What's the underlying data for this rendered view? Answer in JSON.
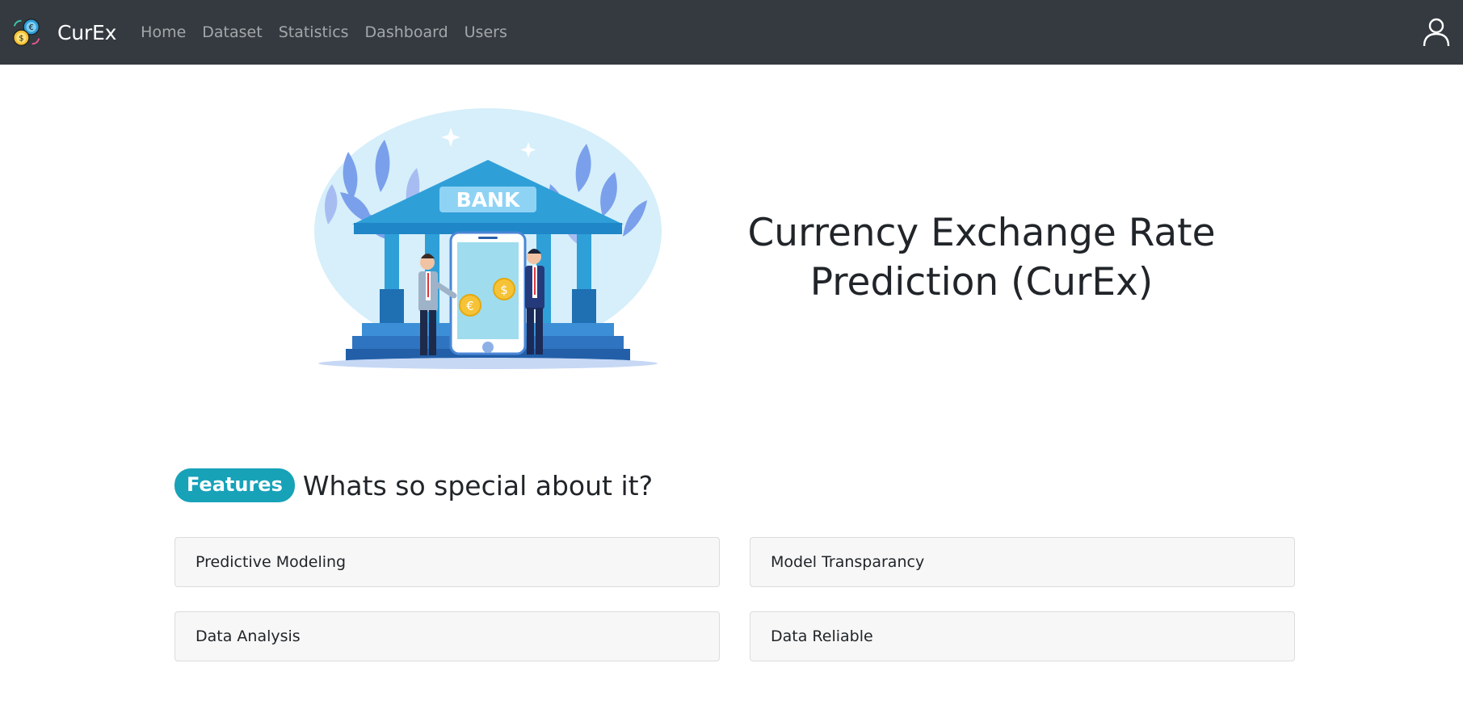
{
  "navbar": {
    "brand": "CurEx",
    "links": [
      "Home",
      "Dataset",
      "Statistics",
      "Dashboard",
      "Users"
    ],
    "user_icon": "user-icon",
    "background": "#343a40"
  },
  "hero": {
    "image_text": "BANK",
    "title_line1": "Currency Exchange Rate",
    "title_line2": "Prediction (CurEx)"
  },
  "features": {
    "badge": "Features",
    "heading": "Whats so special about it?",
    "badge_color": "#17a2b8",
    "items": [
      "Predictive Modeling",
      "Model Transparancy",
      "Data Analysis",
      "Data Reliable"
    ]
  }
}
